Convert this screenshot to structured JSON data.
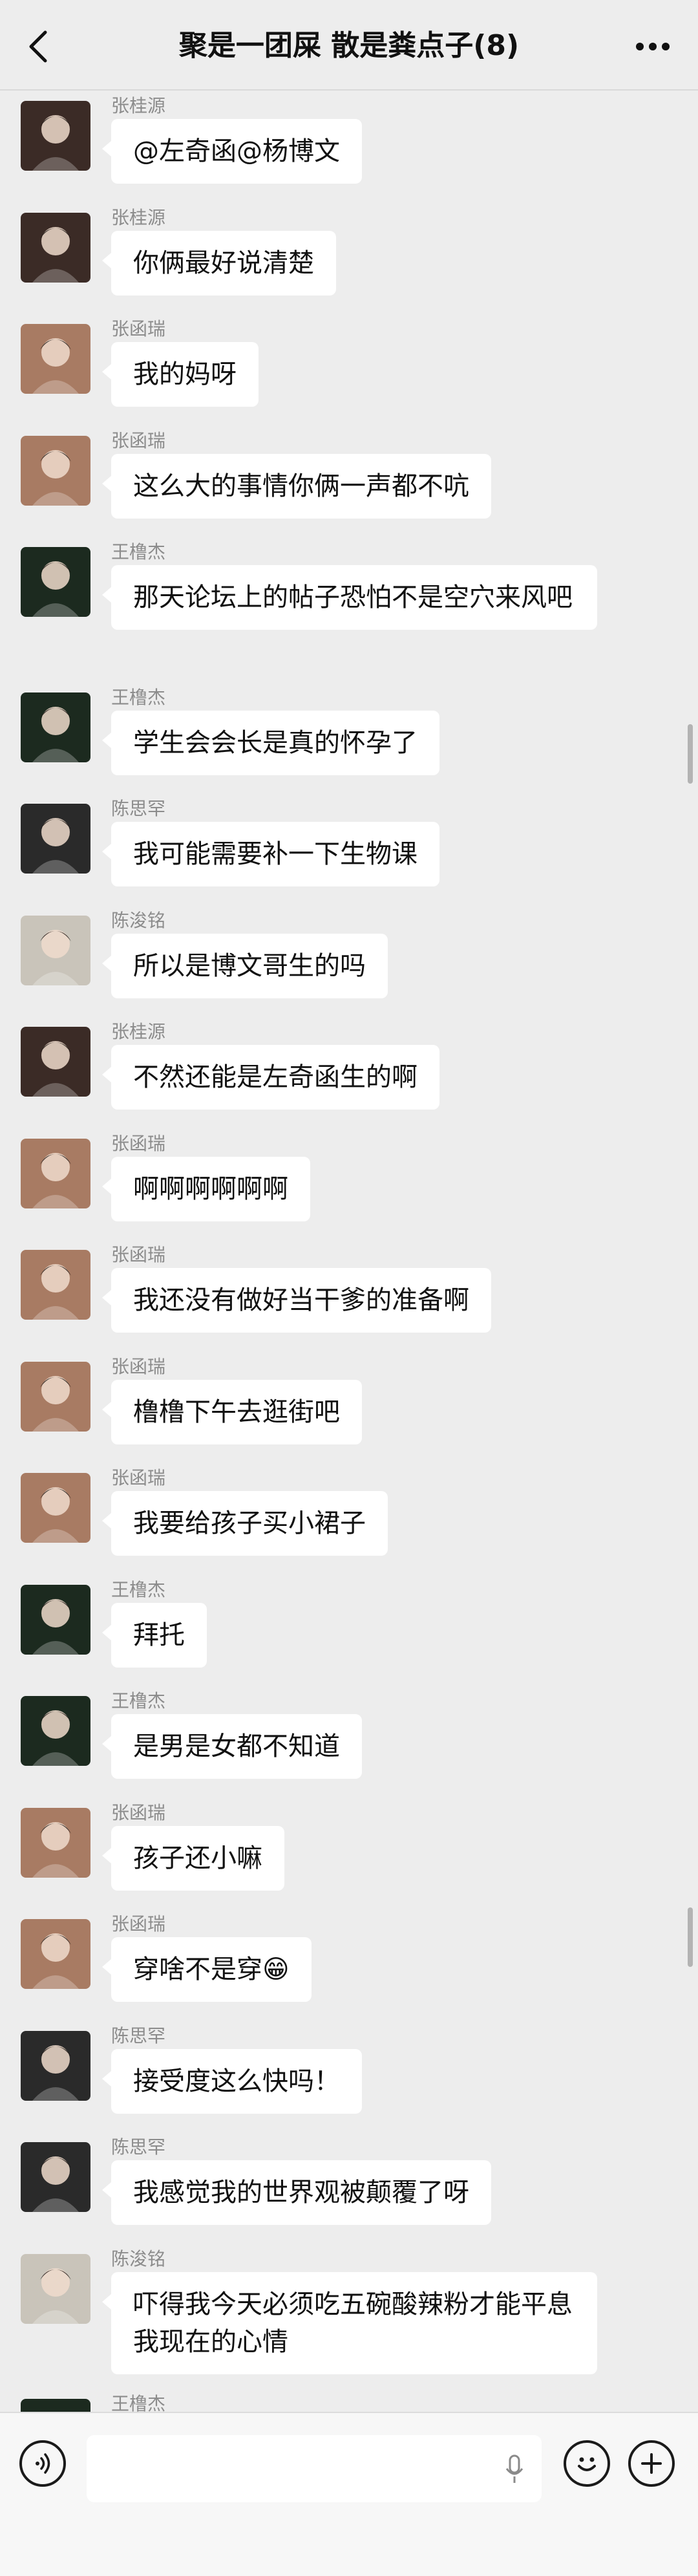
{
  "header": {
    "title": "聚是一团屎 散是粪点子(8)"
  },
  "messages": [
    {
      "sender": "张桂源",
      "text": "@左奇函@杨博文",
      "avatar": "avatar-zhangguiyuan",
      "avatar_color": "#3b2b26"
    },
    {
      "sender": "张桂源",
      "text": "你俩最好说清楚",
      "avatar": "avatar-zhangguiyuan",
      "avatar_color": "#3b2b26"
    },
    {
      "sender": "张函瑞",
      "text": "我的妈呀",
      "avatar": "avatar-zhanghanrui",
      "avatar_color": "#a87b63"
    },
    {
      "sender": "张函瑞",
      "text": "这么大的事情你俩一声都不吭",
      "avatar": "avatar-zhanghanrui",
      "avatar_color": "#a87b63"
    },
    {
      "sender": "王橹杰",
      "text": "那天论坛上的帖子恐怕不是空穴来风吧",
      "avatar": "avatar-wanglujie",
      "avatar_color": "#1c2a1f"
    },
    {
      "sender": "王橹杰",
      "text": "学生会会长是真的怀孕了",
      "avatar": "avatar-wanglujie",
      "avatar_color": "#1c2a1f"
    },
    {
      "sender": "陈思罕",
      "text": "我可能需要补一下生物课",
      "avatar": "avatar-chensihan",
      "avatar_color": "#2a2a2a"
    },
    {
      "sender": "陈浚铭",
      "text": "所以是博文哥生的吗",
      "avatar": "avatar-chenjunming",
      "avatar_color": "#c9c4ba"
    },
    {
      "sender": "张桂源",
      "text": "不然还能是左奇函生的啊",
      "avatar": "avatar-zhangguiyuan",
      "avatar_color": "#3b2b26"
    },
    {
      "sender": "张函瑞",
      "text": "啊啊啊啊啊啊",
      "avatar": "avatar-zhanghanrui",
      "avatar_color": "#a87b63"
    },
    {
      "sender": "张函瑞",
      "text": "我还没有做好当干爹的准备啊",
      "avatar": "avatar-zhanghanrui",
      "avatar_color": "#a87b63"
    },
    {
      "sender": "张函瑞",
      "text": "橹橹下午去逛街吧",
      "avatar": "avatar-zhanghanrui",
      "avatar_color": "#a87b63"
    },
    {
      "sender": "张函瑞",
      "text": "我要给孩子买小裙子",
      "avatar": "avatar-zhanghanrui",
      "avatar_color": "#a87b63"
    },
    {
      "sender": "王橹杰",
      "text": "拜托",
      "avatar": "avatar-wanglujie",
      "avatar_color": "#1c2a1f"
    },
    {
      "sender": "王橹杰",
      "text": "是男是女都不知道",
      "avatar": "avatar-wanglujie",
      "avatar_color": "#1c2a1f"
    },
    {
      "sender": "张函瑞",
      "text": "孩子还小嘛",
      "avatar": "avatar-zhanghanrui",
      "avatar_color": "#a87b63"
    },
    {
      "sender": "张函瑞",
      "text": "穿啥不是穿😁",
      "avatar": "avatar-zhanghanrui",
      "avatar_color": "#a87b63"
    },
    {
      "sender": "陈思罕",
      "text": "接受度这么快吗！",
      "avatar": "avatar-chensihan",
      "avatar_color": "#2a2a2a"
    },
    {
      "sender": "陈思罕",
      "text": "我感觉我的世界观被颠覆了呀",
      "avatar": "avatar-chensihan",
      "avatar_color": "#2a2a2a"
    },
    {
      "sender": "陈浚铭",
      "text": "吓得我今天必须吃五碗酸辣粉才能平息我现在的心情",
      "avatar": "avatar-chenjunming",
      "avatar_color": "#c9c4ba"
    },
    {
      "sender": "王橹杰",
      "text": "",
      "avatar": "avatar-wanglujie",
      "avatar_color": "#1c2a1f"
    }
  ],
  "input_bar": {
    "placeholder": "",
    "icons": [
      "voice-icon",
      "mic-icon",
      "emoji-icon",
      "plus-icon"
    ]
  }
}
